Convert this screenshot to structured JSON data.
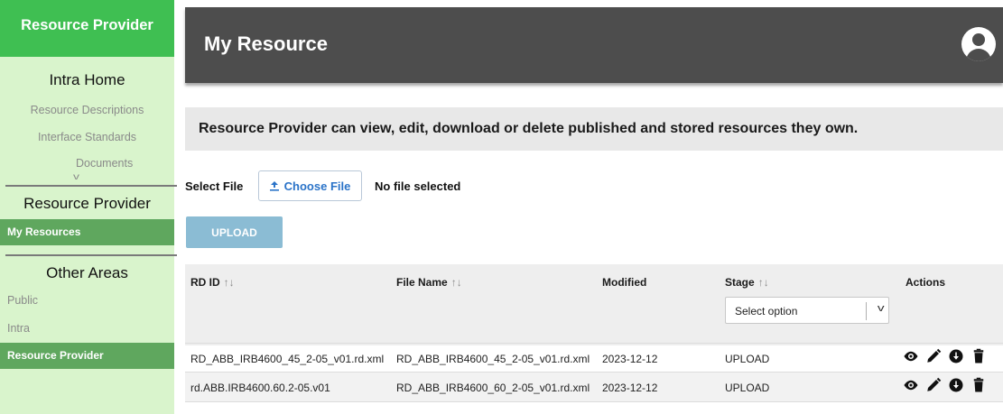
{
  "sidebar": {
    "top_title": "Resource Provider",
    "sections": {
      "intra_home": {
        "heading": "Intra Home",
        "links": [
          "Resource Descriptions",
          "Interface Standards",
          "Documents"
        ]
      },
      "resource_provider": {
        "heading": "Resource Provider",
        "active_item": "My Resources"
      },
      "other_areas": {
        "heading": "Other Areas",
        "links": [
          "Public",
          "Intra"
        ],
        "active_item": "Resource Provider"
      }
    }
  },
  "header": {
    "title": "My Resource"
  },
  "banner": {
    "text": "Resource Provider can view, edit, download or delete published and stored resources they own."
  },
  "upload_form": {
    "select_label": "Select File",
    "choose_button": "Choose File",
    "file_status": "No file selected",
    "upload_button": "UPLOAD"
  },
  "table": {
    "columns": [
      "RD ID",
      "File Name",
      "Modified",
      "Stage",
      "Actions"
    ],
    "stage_filter_placeholder": "Select option",
    "rows": [
      {
        "rd_id": "RD_ABB_IRB4600_45_2-05_v01.rd.xml",
        "file_name": "RD_ABB_IRB4600_45_2-05_v01.rd.xml",
        "modified": "2023-12-12",
        "stage": "UPLOAD"
      },
      {
        "rd_id": "rd.ABB.IRB4600.60.2-05.v01",
        "file_name": "RD_ABB_IRB4600_60_2-05_v01.rd.xml",
        "modified": "2023-12-12",
        "stage": "UPLOAD"
      }
    ],
    "action_icons": [
      "eye-icon",
      "pencil-icon",
      "download-icon",
      "trash-icon"
    ]
  },
  "colors": {
    "sidebar_bg": "#d9f4cc",
    "sidebar_top": "#3fbf52",
    "sidebar_active": "#5fa75e",
    "header_bg": "#4d4d4d",
    "upload_button": "#8bbcd4",
    "link_blue": "#2a73c8"
  }
}
